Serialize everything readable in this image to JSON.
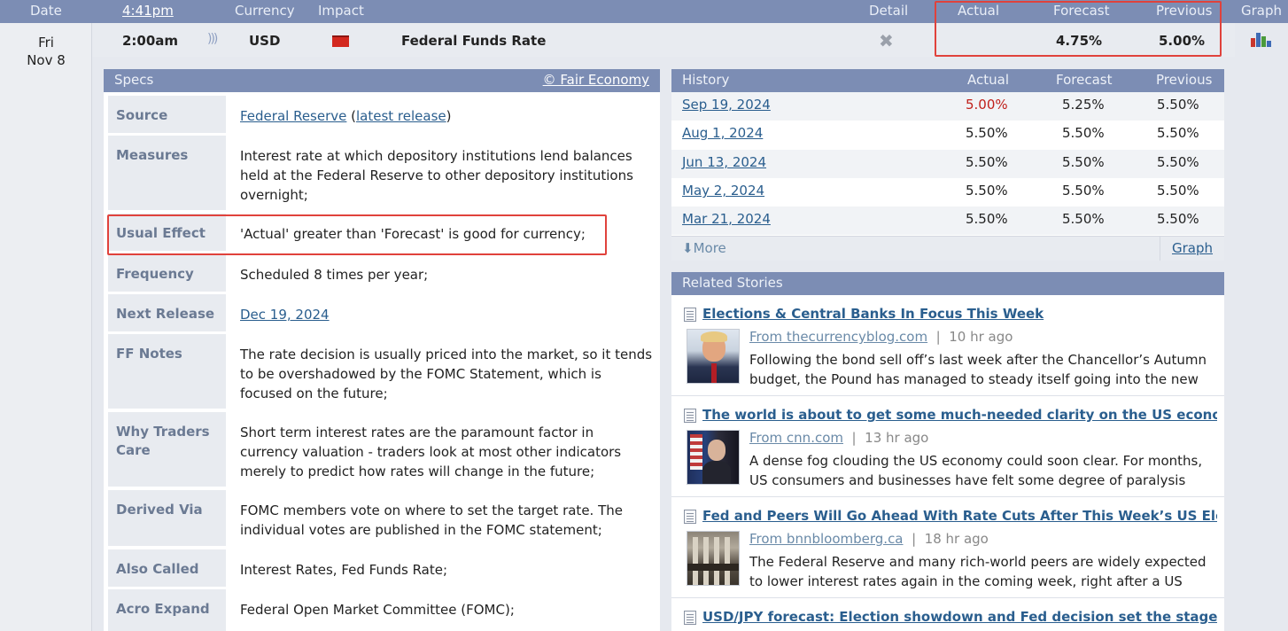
{
  "header": {
    "date": "Date",
    "time": "4:41pm",
    "currency": "Currency",
    "impact": "Impact",
    "detail": "Detail",
    "actual": "Actual",
    "forecast": "Forecast",
    "previous": "Previous",
    "graph": "Graph"
  },
  "event": {
    "day": "Fri",
    "date": "Nov 8",
    "time": "2:00am",
    "currency": "USD",
    "impact_color": "#d3281f",
    "impact_icon": "red-folder-icon",
    "name": "Federal Funds Rate",
    "actual": "",
    "forecast": "4.75%",
    "previous": "5.00%"
  },
  "specs": {
    "title": "Specs",
    "credit": "© Fair Economy",
    "source": {
      "label": "Source",
      "link": "Federal Reserve",
      "open": " (",
      "release": "latest release",
      "close": ")"
    },
    "rows": [
      {
        "label": "Measures",
        "value": "Interest rate at which depository institutions lend balances held at the Federal Reserve to other depository institutions overnight;"
      },
      {
        "label": "Usual Effect",
        "value": "'Actual' greater than 'Forecast' is good for currency;"
      },
      {
        "label": "Frequency",
        "value": "Scheduled 8 times per year;"
      },
      {
        "label": "Next Release",
        "value": "Dec 19, 2024"
      },
      {
        "label": "FF Notes",
        "value": "The rate decision is usually priced into the market, so it tends to be overshadowed by the FOMC Statement, which is focused on the future;"
      },
      {
        "label": "Why Traders Care",
        "value": "Short term interest rates are the paramount factor in currency valuation - traders look at most other indicators merely to predict how rates will change in the future;"
      },
      {
        "label": "Derived Via",
        "value": "FOMC members vote on where to set the target rate. The individual votes are published in the FOMC statement;"
      },
      {
        "label": "Also Called",
        "value": "Interest Rates, Fed Funds Rate;"
      },
      {
        "label": "Acro Expand",
        "value": "Federal Open Market Committee (FOMC);"
      }
    ]
  },
  "history": {
    "title": "History",
    "actual": "Actual",
    "forecast": "Forecast",
    "previous": "Previous",
    "rows": [
      {
        "date": "Sep 19, 2024",
        "actual": "5.00%",
        "forecast": "5.25%",
        "previous": "5.50%",
        "actual_color": "#c0201b"
      },
      {
        "date": "Aug 1, 2024",
        "actual": "5.50%",
        "forecast": "5.50%",
        "previous": "5.50%",
        "actual_color": "#222222"
      },
      {
        "date": "Jun 13, 2024",
        "actual": "5.50%",
        "forecast": "5.50%",
        "previous": "5.50%",
        "actual_color": "#222222"
      },
      {
        "date": "May 2, 2024",
        "actual": "5.50%",
        "forecast": "5.50%",
        "previous": "5.50%",
        "actual_color": "#222222"
      },
      {
        "date": "Mar 21, 2024",
        "actual": "5.50%",
        "forecast": "5.50%",
        "previous": "5.50%",
        "actual_color": "#222222"
      }
    ],
    "more": "More",
    "graph": "Graph"
  },
  "related": {
    "title": "Related Stories",
    "stories": [
      {
        "title": "Elections & Central Banks In Focus This Week",
        "source": "From thecurrencyblog.com",
        "sep": "|",
        "age": "10 hr ago",
        "summary": "Following the bond sell off’s last week after the Chancellor’s Autumn budget, the Pound has managed to steady itself going into the new"
      },
      {
        "title": "The world is about to get some much-needed clarity on the US economy",
        "source": "From cnn.com",
        "sep": "|",
        "age": "13 hr ago",
        "summary": "A dense fog clouding the US economy could soon clear. For months, US consumers and businesses have felt some degree of paralysis"
      },
      {
        "title": "Fed and Peers Will Go Ahead With Rate Cuts After This Week’s US Election",
        "source": "From bnnbloomberg.ca",
        "sep": "|",
        "age": "18 hr ago",
        "summary": "The Federal Reserve and many rich-world peers are widely expected to lower interest rates again in the coming week, right after a US"
      },
      {
        "title": "USD/JPY forecast: Election showdown and Fed decision set the stage",
        "source": "",
        "sep": "",
        "age": "",
        "summary": ""
      }
    ]
  },
  "colors": {
    "header_bg": "#7c8db4",
    "highlight": "#e0423c",
    "link": "#2a5e8e"
  }
}
